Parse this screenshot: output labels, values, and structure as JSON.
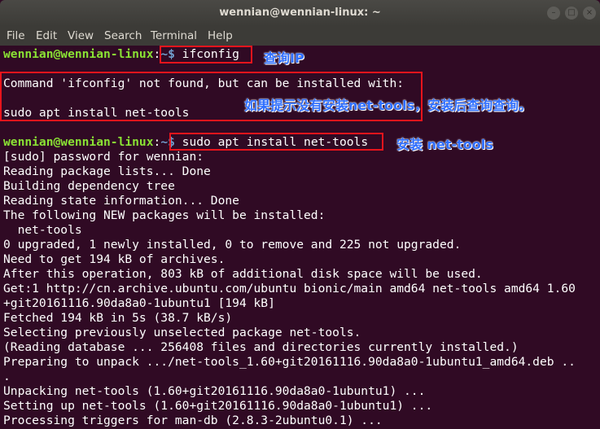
{
  "window": {
    "title": "wennian@wennian-linux: ~",
    "minimize_glyph": "–",
    "maximize_glyph": "□",
    "close_glyph": "×"
  },
  "menu": [
    "File",
    "Edit",
    "View",
    "Search",
    "Terminal",
    "Help"
  ],
  "prompt": {
    "user_host": "wennian@wennian-linux",
    "colon": ":",
    "path_symbol": "~$ "
  },
  "commands": {
    "first": "ifconfig",
    "second": "sudo apt install net-tools"
  },
  "output_error": [
    "Command 'ifconfig' not found, but can be installed with:",
    "",
    "sudo apt install net-tools"
  ],
  "output_install": [
    "[sudo] password for wennian:",
    "Reading package lists... Done",
    "Building dependency tree",
    "Reading state information... Done",
    "The following NEW packages will be installed:",
    "  net-tools",
    "0 upgraded, 1 newly installed, 0 to remove and 225 not upgraded.",
    "Need to get 194 kB of archives.",
    "After this operation, 803 kB of additional disk space will be used.",
    "Get:1 http://cn.archive.ubuntu.com/ubuntu bionic/main amd64 net-tools amd64 1.60",
    "+git20161116.90da8a0-1ubuntu1 [194 kB]",
    "Fetched 194 kB in 5s (38.7 kB/s)",
    "Selecting previously unselected package net-tools.",
    "(Reading database ... 256408 files and directories currently installed.)",
    "Preparing to unpack .../net-tools_1.60+git20161116.90da8a0-1ubuntu1_amd64.deb ..",
    ".",
    "Unpacking net-tools (1.60+git20161116.90da8a0-1ubuntu1) ...",
    "Setting up net-tools (1.60+git20161116.90da8a0-1ubuntu1) ...",
    "Processing triggers for man-db (2.8.3-2ubuntu0.1) ..."
  ],
  "annotations": {
    "query_ip": "查询IP",
    "hint": "如果提示没有安装net-tools，安装后查询查询。",
    "install": "安装 net-tools"
  },
  "colors": {
    "terminal_bg": "#300a24",
    "prompt_green": "#8ae234",
    "prompt_blue": "#729fcf",
    "highlight_red": "#e8141c",
    "annotation_blue": "#2f6fff"
  }
}
